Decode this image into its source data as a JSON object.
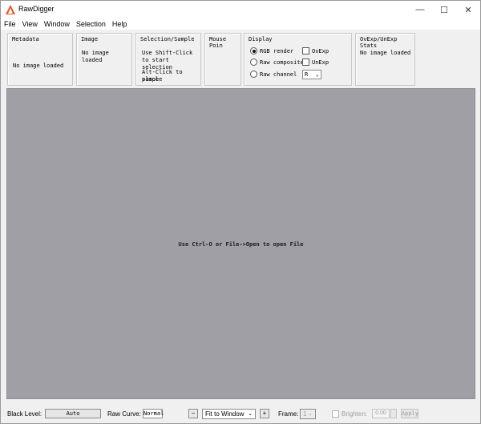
{
  "window": {
    "title": "RawDigger",
    "minimize_glyph": "—",
    "maximize_glyph": "☐",
    "close_glyph": "✕"
  },
  "menu": [
    "File",
    "View",
    "Window",
    "Selection",
    "Help"
  ],
  "panels": {
    "metadata": {
      "title": "Metadata",
      "status": "No image loaded"
    },
    "image": {
      "title": "Image",
      "status": "No image loaded"
    },
    "selection": {
      "title": "Selection/Sample",
      "line1": "Use Shift-Click",
      "line2": "to start selection",
      "line3": "Alt-Click to place",
      "line4": "sample"
    },
    "mouse": {
      "title": "Mouse Poin"
    },
    "display": {
      "title": "Display",
      "rgb_render": "RGB render",
      "raw_composite": "Raw composite",
      "raw_channel": "Raw channel",
      "ovexp": "OvExp",
      "unexp": "UnExp",
      "channel_value": "R",
      "selected_mode": "RGB render"
    },
    "stats": {
      "title": "OvExp/UnExp Stats",
      "status": "No image loaded"
    }
  },
  "canvas": {
    "message": "Use Ctrl-O or File->Open to open File"
  },
  "statusbar": {
    "black_level_label": "Black Level:",
    "black_level_value": "Auto",
    "raw_curve_label": "Raw Curve:",
    "raw_curve_value": "Normal",
    "zoom_out": "−",
    "zoom_mode": "Fit to Window",
    "zoom_in": "+",
    "frame_label": "Frame:",
    "frame_value": "1",
    "brighten_label": "Brighten:",
    "brighten_value": "0.00",
    "apply_label": "Apply"
  },
  "colors": {
    "canvas_bg": "#a09fa6",
    "app_icon": "#e8531f"
  }
}
